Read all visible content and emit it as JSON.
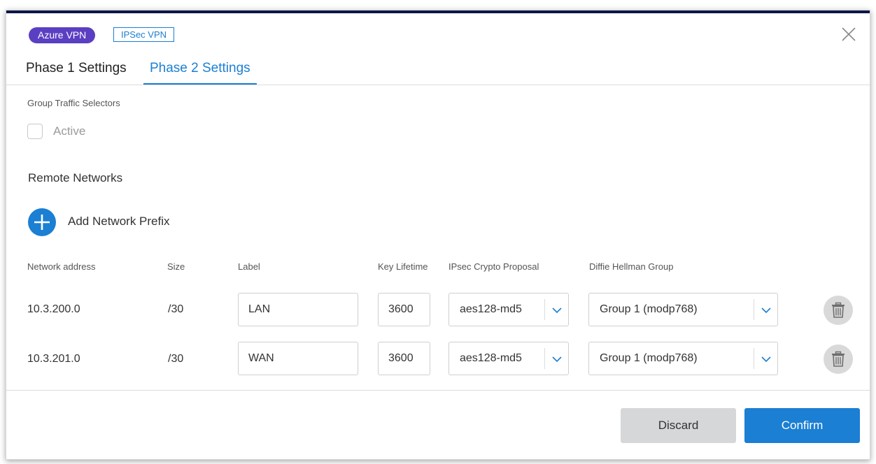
{
  "badges": {
    "azure": "Azure VPN",
    "ipsec": "IPSec VPN"
  },
  "tabs": [
    {
      "label": "Phase 1 Settings",
      "active": false
    },
    {
      "label": "Phase 2 Settings",
      "active": true
    }
  ],
  "group_traffic": {
    "label": "Group Traffic Selectors",
    "checkbox_label": "Active",
    "checked": false
  },
  "remote_networks": {
    "title": "Remote Networks",
    "add_label": "Add Network Prefix",
    "columns": [
      "Network address",
      "Size",
      "Label",
      "Key Lifetime",
      "IPsec Crypto Proposal",
      "Diffie Hellman Group"
    ],
    "rows": [
      {
        "network": "10.3.200.0",
        "size": "/30",
        "label": "LAN",
        "lifetime": "3600",
        "proposal": "aes128-md5",
        "dh_group": "Group 1 (modp768)"
      },
      {
        "network": "10.3.201.0",
        "size": "/30",
        "label": "WAN",
        "lifetime": "3600",
        "proposal": "aes128-md5",
        "dh_group": "Group 1 (modp768)"
      }
    ]
  },
  "footer": {
    "discard": "Discard",
    "confirm": "Confirm"
  },
  "colors": {
    "accent": "#1b7fd3",
    "azure_badge": "#5b3fc2",
    "topbar": "#0b1746"
  },
  "icons": {
    "close": "close-icon",
    "add": "plus-icon",
    "dropdown": "chevron-down-icon",
    "delete": "trash-icon"
  }
}
